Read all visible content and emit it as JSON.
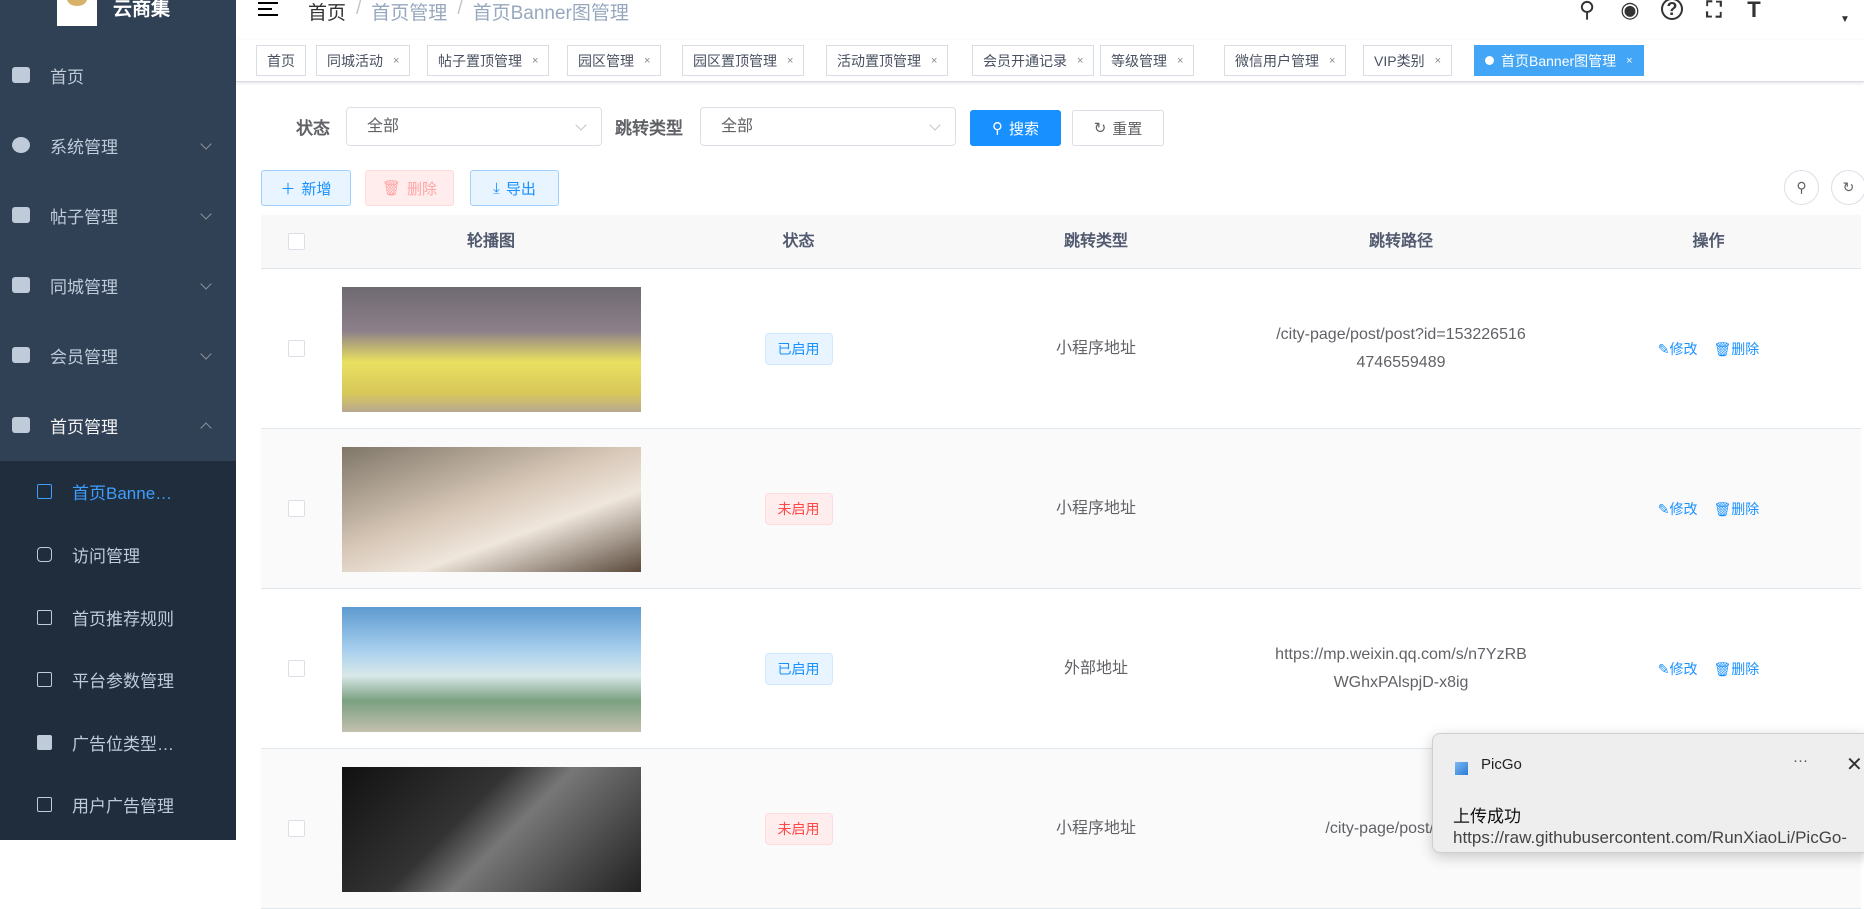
{
  "sidebar": {
    "logo_text": "云商集",
    "items": [
      {
        "label": "首页",
        "icon": "dashboard-icon"
      },
      {
        "label": "系统管理",
        "icon": "gear-icon"
      },
      {
        "label": "帖子管理",
        "icon": "edit-icon"
      },
      {
        "label": "同城管理",
        "icon": "table-icon"
      },
      {
        "label": "会员管理",
        "icon": "users-icon"
      },
      {
        "label": "首页管理",
        "icon": "home-icon"
      }
    ],
    "subitems": [
      {
        "label": "首页Banne…",
        "active": true
      },
      {
        "label": "访问管理"
      },
      {
        "label": "首页推荐规则"
      },
      {
        "label": "平台参数管理"
      },
      {
        "label": "广告位类型…"
      },
      {
        "label": "用户广告管理"
      }
    ]
  },
  "breadcrumb": [
    "首页",
    "首页管理",
    "首页Banner图管理"
  ],
  "breadcrumb_sep": "/",
  "navbar_icons": [
    "search-icon",
    "github-icon",
    "question-icon",
    "fullscreen-icon",
    "font-size-icon"
  ],
  "tags": [
    {
      "label": "首页",
      "closable": false
    },
    {
      "label": "同城活动"
    },
    {
      "label": "帖子置顶管理"
    },
    {
      "label": "园区管理"
    },
    {
      "label": "园区置顶管理"
    },
    {
      "label": "活动置顶管理"
    },
    {
      "label": "会员开通记录"
    },
    {
      "label": "等级管理"
    },
    {
      "label": "微信用户管理"
    },
    {
      "label": "VIP类别"
    },
    {
      "label": "首页Banner图管理",
      "active": true
    }
  ],
  "tag_close": "×",
  "filters": {
    "status_label": "状态",
    "status_value": "全部",
    "type_label": "跳转类型",
    "type_value": "全部",
    "search": "搜索",
    "reset": "重置"
  },
  "toolbar": {
    "add": "新增",
    "delete": "删除",
    "export": "导出"
  },
  "table": {
    "headers": [
      "轮播图",
      "状态",
      "跳转类型",
      "跳转路径",
      "操作"
    ],
    "rows": [
      {
        "status": "已启用",
        "status_on": true,
        "type": "小程序地址",
        "path1": "/city-page/post/post?id=153226516",
        "path2": "4746559489"
      },
      {
        "status": "未启用",
        "status_on": false,
        "type": "小程序地址",
        "path1": "",
        "path2": ""
      },
      {
        "status": "已启用",
        "status_on": true,
        "type": "外部地址",
        "path1": "https://mp.weixin.qq.com/s/n7YzRB",
        "path2": "WGhxPAlspjD-x8ig"
      },
      {
        "status": "未启用",
        "status_on": false,
        "type": "小程序地址",
        "path1": "/city-page/post/post?i",
        "path2": ""
      }
    ],
    "edit": "修改",
    "remove": "删除"
  },
  "notification": {
    "app": "PicGo",
    "more": "···",
    "close": "✕",
    "title": "上传成功",
    "url": "https://raw.githubusercontent.com/RunXiaoLi/PicGo-"
  },
  "colors": {
    "sidebar": "#304156",
    "submenu": "#1f2d3d",
    "primary": "#1890ff",
    "tag_active": "#42a5f5"
  }
}
